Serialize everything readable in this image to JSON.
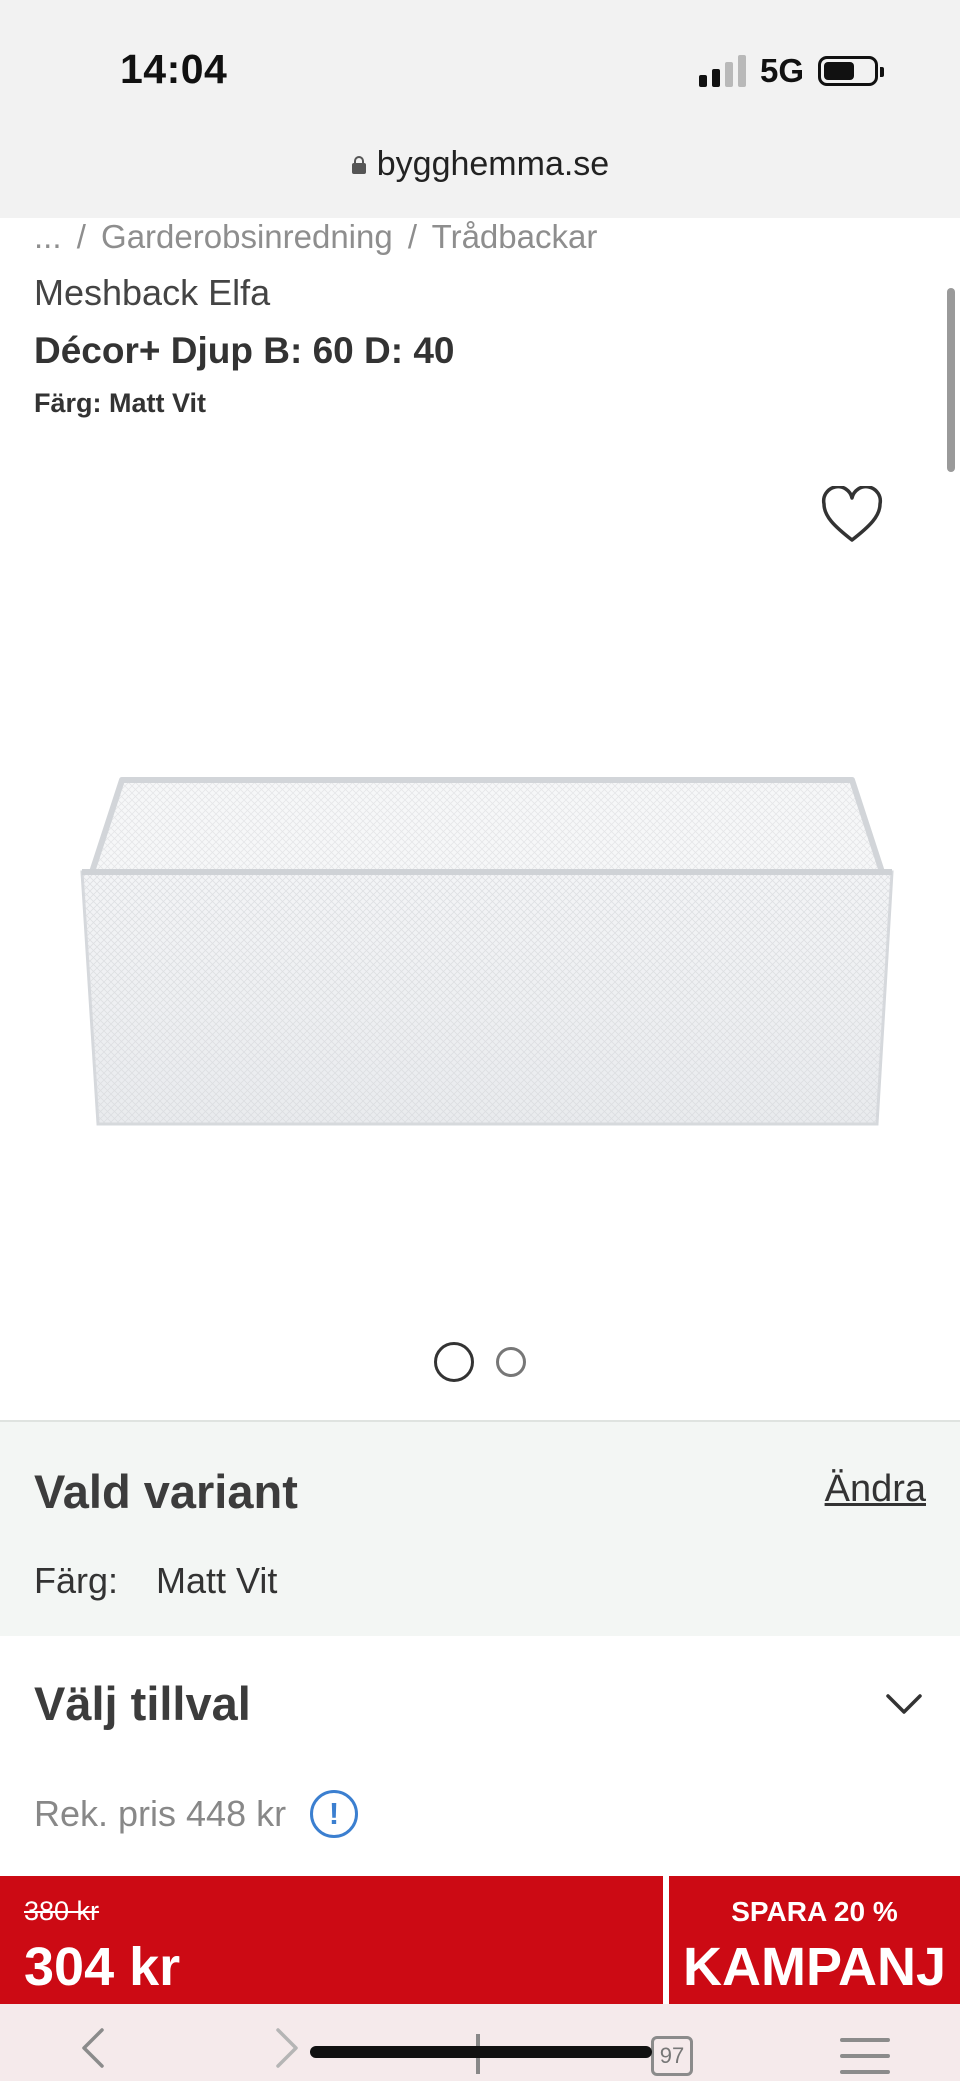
{
  "status_bar": {
    "time": "14:04",
    "network": "5G",
    "battery_level": 0.62
  },
  "browser": {
    "url": "bygghemma.se",
    "tab_count": "97"
  },
  "breadcrumb": [
    "...",
    "/",
    "Garderobsinredning",
    "/",
    "Trådbackar"
  ],
  "product": {
    "brand_title": "Meshback Elfa",
    "name": "Décor+ Djup B: 60 D: 40",
    "color_line": "Färg: Matt Vit",
    "image_count": 2,
    "active_image": 1
  },
  "variant": {
    "title": "Vald variant",
    "change_label": "Ändra",
    "attribute_label": "Färg:",
    "attribute_value": "Matt Vit"
  },
  "options": {
    "title": "Välj tillval"
  },
  "recommended_price": "Rek. pris 448 kr",
  "info_symbol": "!",
  "price_bar": {
    "old_price": "380 kr",
    "price": "304 kr",
    "savings": "SPARA 20 %",
    "campaign": "KAMPANJ"
  },
  "colors": {
    "price_bar": "#cc0a14",
    "info_accent": "#3b7fd0",
    "variant_bg": "#f3f6f4"
  }
}
